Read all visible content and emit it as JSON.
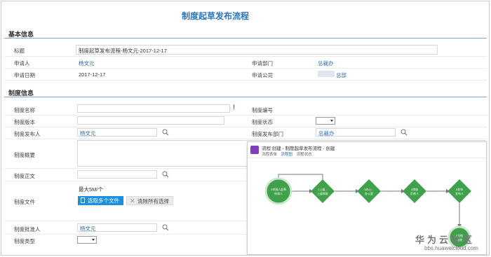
{
  "page_title": "制度起草发布流程",
  "sections": {
    "basic": "基本信息",
    "rule": "制度信息"
  },
  "basic": {
    "title_label": "标题",
    "title_value": "制度起草发布流程-杨文元-2017-12-17",
    "applicant_label": "申请人",
    "applicant_value": "杨文元",
    "dept_label": "申请部门",
    "dept_value": "总裁办",
    "date_label": "申请日期",
    "date_value": "2017-12-17",
    "company_label": "申请公司",
    "company_value": "总部"
  },
  "rule": {
    "name_label": "制度名称",
    "number_label": "制度编号",
    "version_label": "制度版本",
    "status_label": "制度状态",
    "publisher_label": "制度发布人",
    "publisher_value": "杨文元",
    "publish_dept_label": "制度发布部门",
    "publish_dept_value": "总裁办",
    "summary_label": "制度概要",
    "body_label": "制度正文",
    "file_label": "制度文件",
    "file_limit": "最大5M/个",
    "select_files": "选取多个文件",
    "clear_selection": "清除所有选择",
    "approver_label": "制度批准人",
    "approver_value": "杨文元",
    "type_label": "制度类型"
  },
  "overlay": {
    "title": "流程:创建 - 制度起草发布流程 - 创建",
    "tabs": [
      "流程表单",
      "流程图",
      "流程状态"
    ],
    "active_tab": 1,
    "nodes": [
      "1申请人起草\n申请人",
      "2上级...\n上级审批",
      "3办公...\n办公室",
      "4审核\n负责人",
      "5发布\n发布人",
      "6归档\n结束"
    ]
  },
  "watermark": {
    "line1": "华为云社区",
    "line2": "bbs.huaweicloud.com"
  }
}
